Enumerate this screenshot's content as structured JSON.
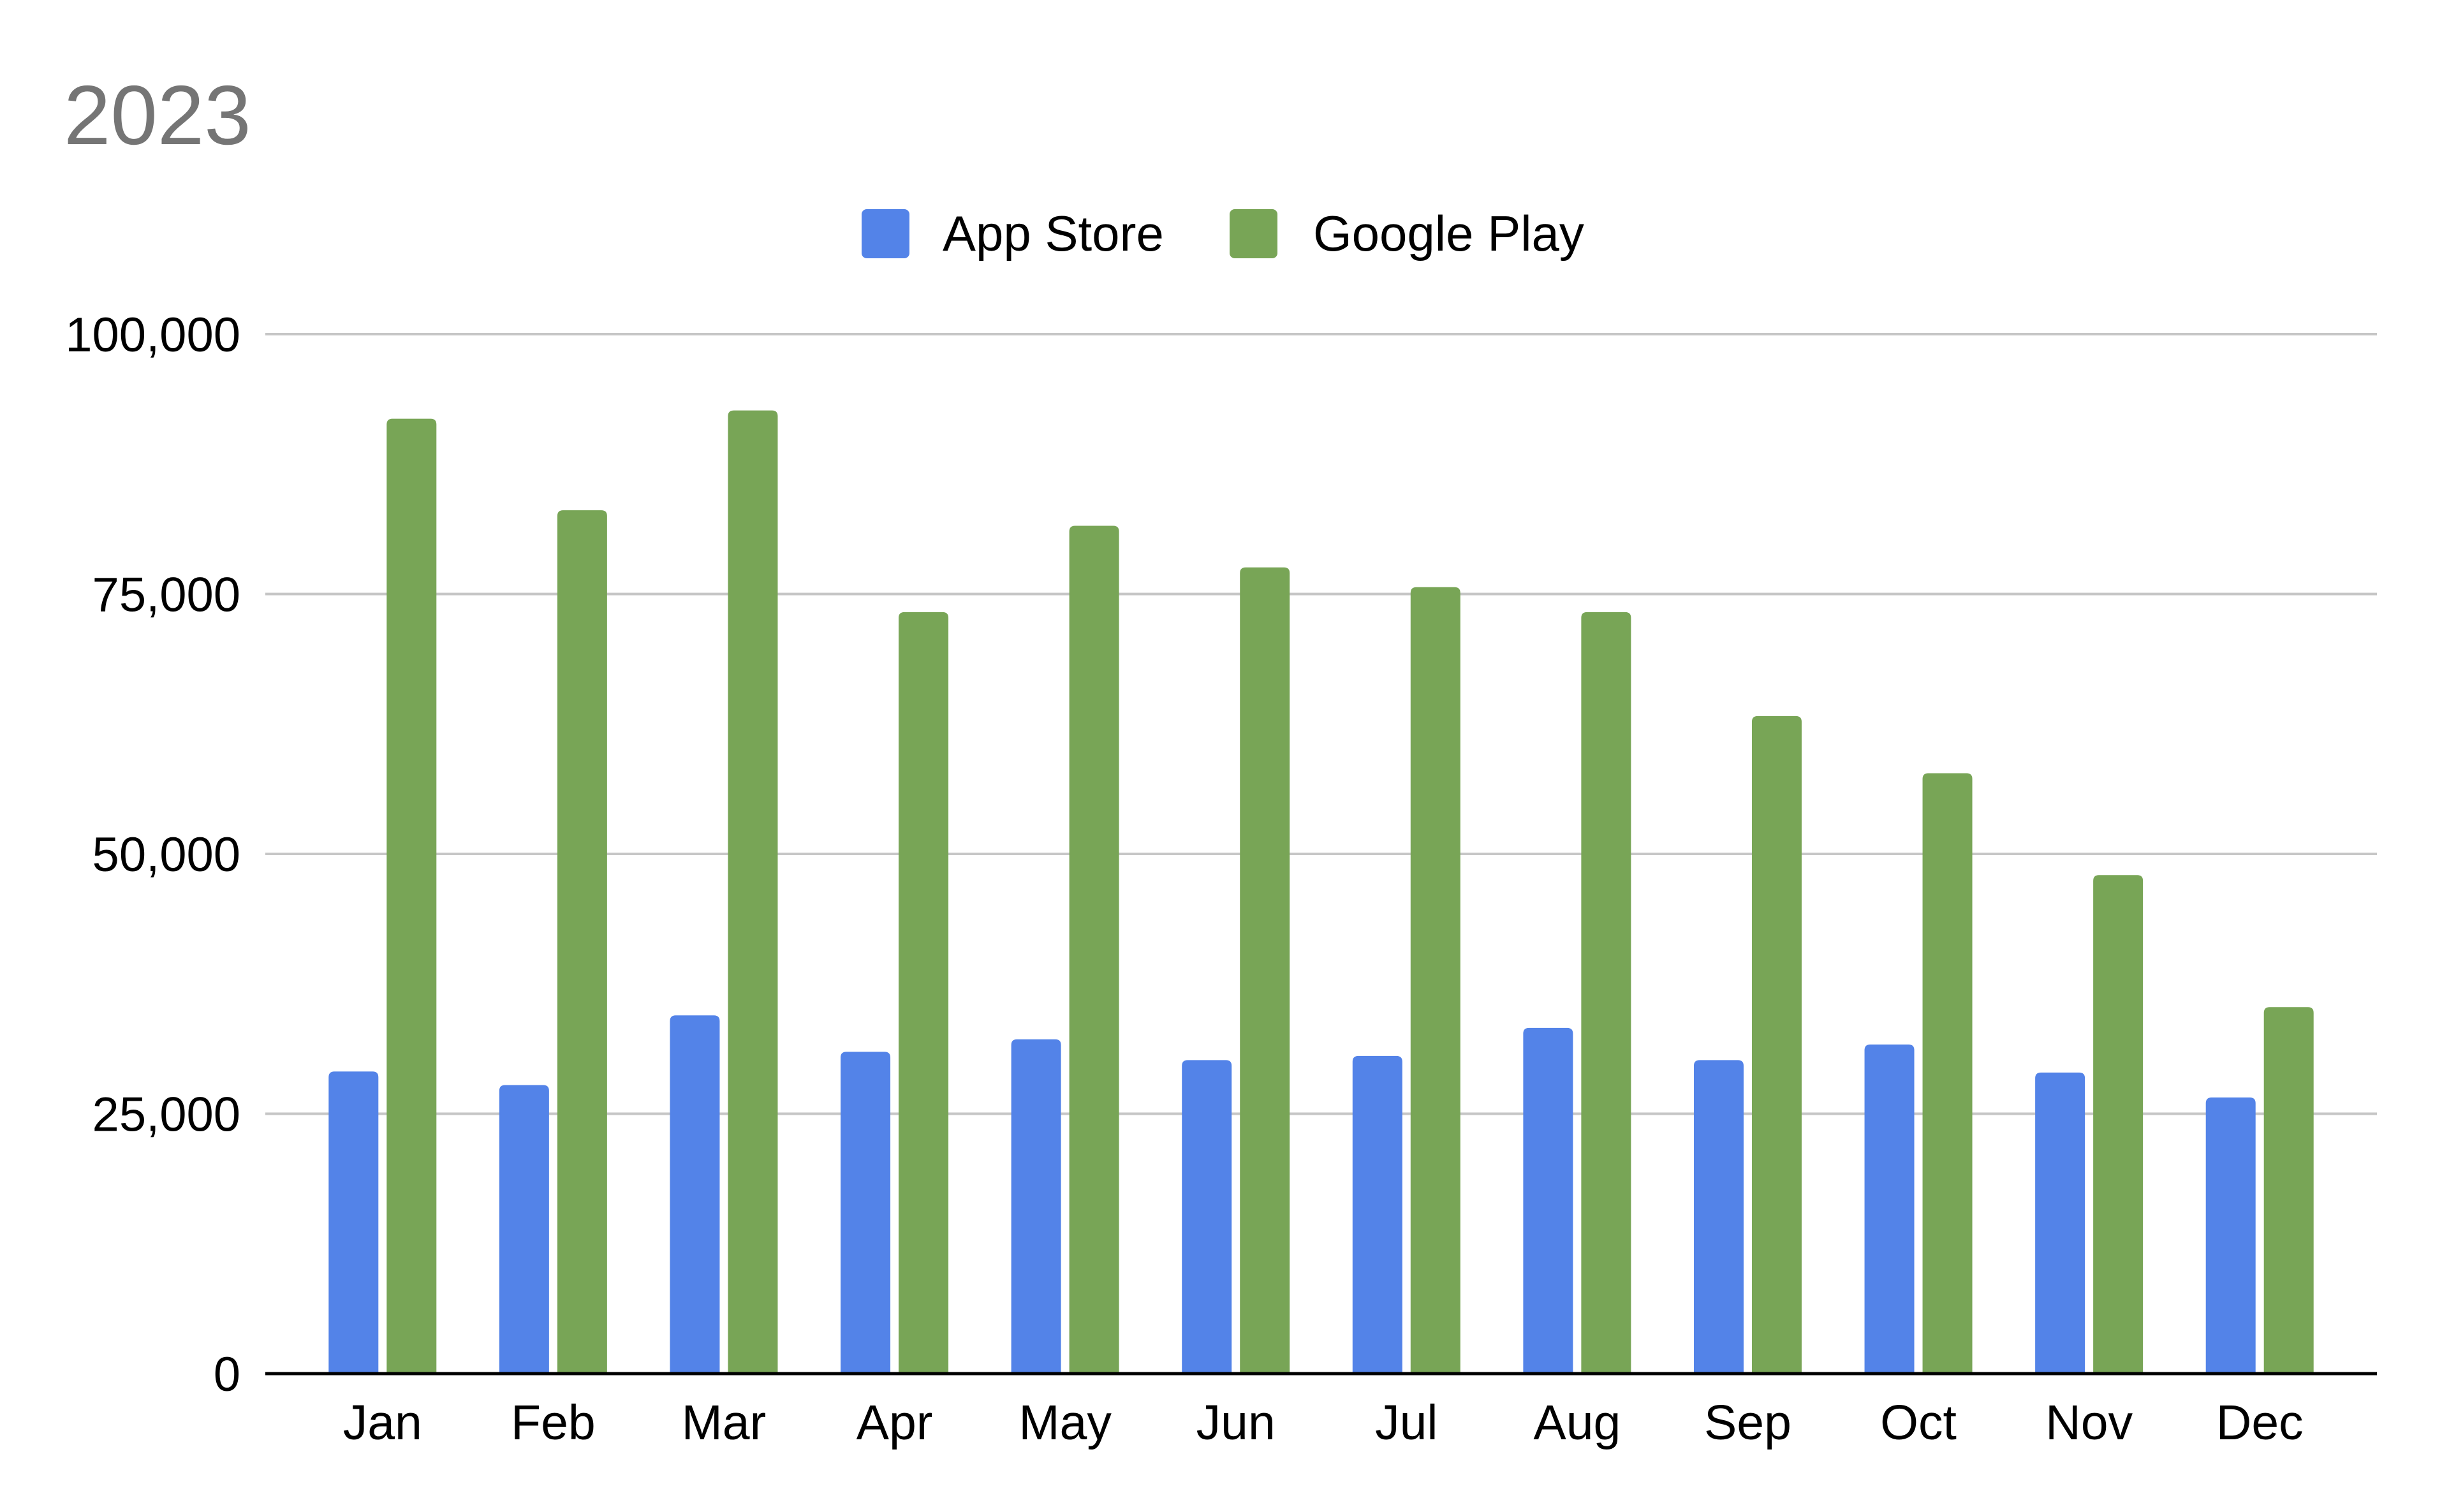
{
  "chart_data": {
    "type": "bar",
    "title": "2023",
    "xlabel": "",
    "ylabel": "",
    "categories": [
      "Jan",
      "Feb",
      "Mar",
      "Apr",
      "May",
      "Jun",
      "Jul",
      "Aug",
      "Sep",
      "Oct",
      "Nov",
      "Dec"
    ],
    "series": [
      {
        "name": "App Store",
        "color": "#5383E8",
        "values": [
          29000,
          27700,
          34400,
          30900,
          32100,
          30100,
          30500,
          33200,
          30100,
          31600,
          28900,
          26500
        ]
      },
      {
        "name": "Google Play",
        "color": "#78A556",
        "values": [
          91800,
          83000,
          92600,
          73200,
          81500,
          77500,
          75600,
          73200,
          63200,
          57700,
          47900,
          35200
        ]
      }
    ],
    "ylim": [
      0,
      100000
    ],
    "yticks": [
      0,
      25000,
      50000,
      75000,
      100000
    ],
    "ytick_labels": [
      "0",
      "25,000",
      "50,000",
      "75,000",
      "100,000"
    ],
    "grid": true,
    "legend_position": "top-center"
  }
}
